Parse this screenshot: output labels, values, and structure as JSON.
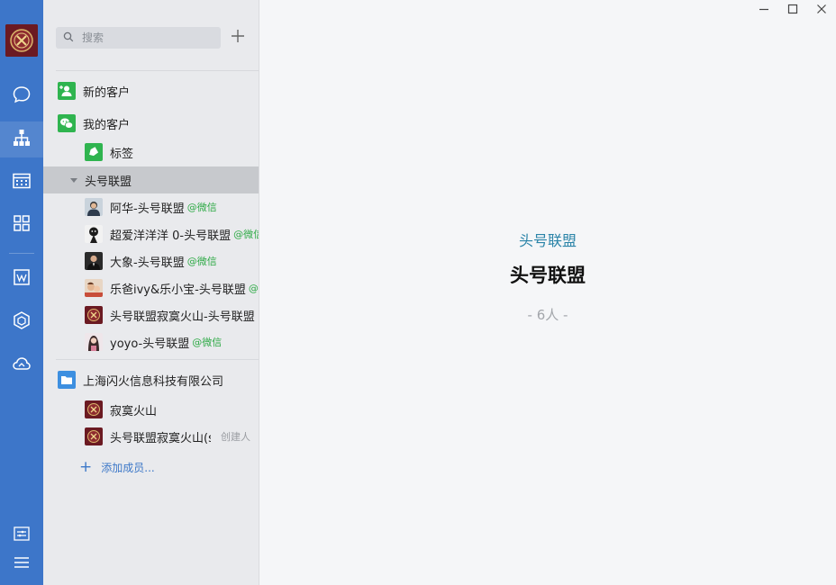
{
  "search": {
    "placeholder": "搜索"
  },
  "nav": [
    {
      "name": "chat",
      "icon": "chat-bubble-icon"
    },
    {
      "name": "contacts",
      "icon": "org-chart-icon",
      "active": true
    },
    {
      "name": "calendar",
      "icon": "calendar-icon"
    },
    {
      "name": "apps",
      "icon": "apps-grid-icon"
    },
    {
      "name": "docs",
      "icon": "document-icon"
    },
    {
      "name": "workbench",
      "icon": "hexagon-icon"
    },
    {
      "name": "cloud",
      "icon": "cloud-icon"
    },
    {
      "name": "settings",
      "icon": "sliders-icon"
    },
    {
      "name": "menu",
      "icon": "hamburger-icon"
    }
  ],
  "contacts": {
    "new_customers": "新的客户",
    "my_customers": "我的客户",
    "tags": "标签",
    "group": {
      "name": "头号联盟",
      "members": [
        {
          "name": "阿华-头号联盟",
          "suffix": "@微信"
        },
        {
          "name": "超爱洋洋洋 0-头号联盟",
          "suffix": "@微信"
        },
        {
          "name": "大象-头号联盟",
          "suffix": "@微信"
        },
        {
          "name": "乐爸ivy&乐小宝-头号联盟",
          "suffix": "@"
        },
        {
          "name": "头号联盟寂寞火山-头号联盟",
          "suffix": ""
        },
        {
          "name": "yoyo-头号联盟",
          "suffix": "@微信"
        }
      ]
    },
    "company": {
      "name": "上海闪火信息科技有限公司",
      "members": [
        {
          "name": "寂寞火山",
          "suffix": ""
        },
        {
          "name": "头号联盟寂寞火山(s",
          "suffix": "创建人"
        }
      ]
    },
    "add_member": "添加成员..."
  },
  "detail": {
    "group_label": "头号联盟",
    "group_title": "头号联盟",
    "member_count": "- 6人 -"
  },
  "colors": {
    "rail": "#3d76c9",
    "panel": "#e9eaed",
    "selected_row": "#c7c9cd",
    "accent_link": "#3d78c8",
    "wechat_green": "#2eaa46",
    "title_teal": "#2b84a8"
  }
}
